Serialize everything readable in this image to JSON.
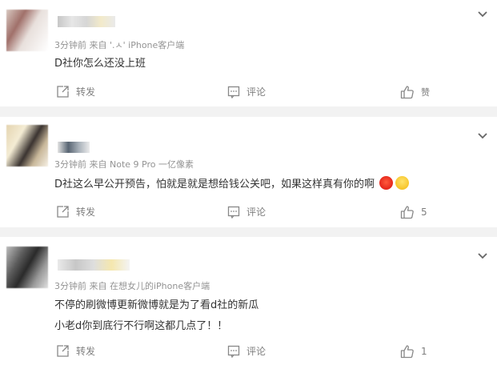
{
  "comments": [
    {
      "name": "",
      "meta": "3分钟前  来自 '.ㅅ' iPhone客户端",
      "lines": [
        "D社你怎么还没上班"
      ],
      "actions": {
        "repost": "转发",
        "comment": "评论",
        "like": "赞"
      }
    },
    {
      "name": "",
      "meta": "3分钟前  来自 Note 9 Pro 一亿像素",
      "lines": [
        "D社这么早公开预告，怕就是就是想给钱公关吧，如果这样真有你的啊"
      ],
      "actions": {
        "repost": "转发",
        "comment": "评论",
        "like": "5"
      }
    },
    {
      "name": "",
      "meta": "3分钟前  来自 在想女儿的iPhone客户端",
      "lines": [
        "不停的刷微博更新微博就是为了看d社的新瓜",
        "小老d你到底行不行啊这都几点了！！"
      ],
      "actions": {
        "repost": "转发",
        "comment": "评论",
        "like": "1"
      }
    }
  ],
  "icons": {
    "more": "chevron-down-icon",
    "repost": "share-icon",
    "comment": "comment-icon",
    "like": "thumbs-up-icon",
    "emoji1": "angry-face-icon",
    "emoji2": "smile-face-icon"
  }
}
